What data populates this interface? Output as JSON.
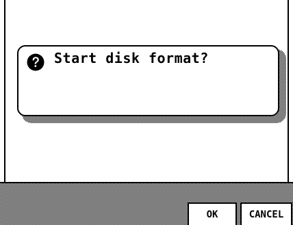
{
  "dialog": {
    "icon": "question-icon",
    "message": "Start disk format?"
  },
  "buttons": {
    "ok_label": "OK",
    "cancel_label": "CANCEL"
  }
}
